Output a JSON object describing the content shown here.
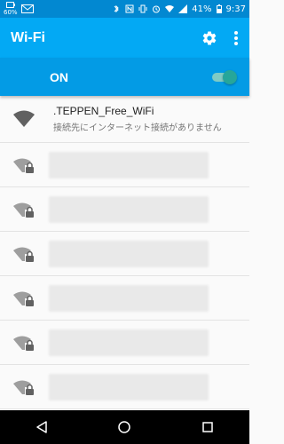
{
  "status_bar": {
    "battery_small": "60%",
    "battery_percent": "41%",
    "time": "9:37"
  },
  "app_bar": {
    "title": "Wi-Fi"
  },
  "wifi_switch": {
    "label": "ON",
    "state": "on"
  },
  "networks": [
    {
      "ssid": ".TEPPEN_Free_WiFi",
      "status": "接続先にインターネット接続がありません",
      "secured": false
    },
    {
      "ssid": "",
      "secured": true
    },
    {
      "ssid": "",
      "secured": true
    },
    {
      "ssid": "",
      "secured": true
    },
    {
      "ssid": "",
      "secured": true
    },
    {
      "ssid": "",
      "secured": true
    },
    {
      "ssid": "",
      "secured": true
    },
    {
      "ssid": "",
      "secured": true
    }
  ],
  "colors": {
    "statusbar": "#0288d1",
    "appbar": "#03a9f4",
    "switchbar": "#039be5",
    "toggle_on": "#26a69a"
  }
}
